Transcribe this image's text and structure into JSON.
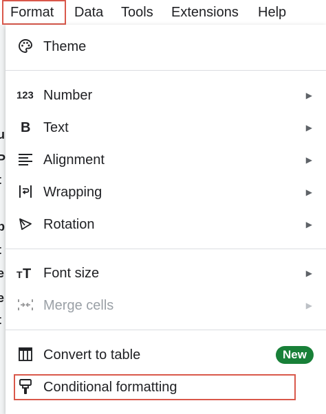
{
  "menubar": {
    "items": [
      {
        "label": "Format"
      },
      {
        "label": "Data"
      },
      {
        "label": "Tools"
      },
      {
        "label": "Extensions"
      },
      {
        "label": "Help"
      }
    ]
  },
  "menu": {
    "theme": {
      "label": "Theme",
      "icon": "palette-icon"
    },
    "number": {
      "label": "Number",
      "icon": "number-123-icon"
    },
    "text": {
      "label": "Text",
      "icon": "bold-icon"
    },
    "alignment": {
      "label": "Alignment",
      "icon": "align-left-icon"
    },
    "wrapping": {
      "label": "Wrapping",
      "icon": "text-wrap-icon"
    },
    "rotation": {
      "label": "Rotation",
      "icon": "text-rotation-icon"
    },
    "font_size": {
      "label": "Font size",
      "icon": "font-size-icon"
    },
    "merge_cells": {
      "label": "Merge cells",
      "icon": "merge-cells-icon",
      "disabled": true
    },
    "convert_to_table": {
      "label": "Convert to table",
      "icon": "table-icon",
      "badge": "New"
    },
    "conditional_formatting": {
      "label": "Conditional formatting",
      "icon": "paint-roller-icon"
    },
    "submenu_arrow": "▶"
  },
  "sheet_edge": [
    "u",
    "P",
    "t",
    "i",
    "p",
    "t",
    "e",
    "e",
    "t"
  ],
  "colors": {
    "highlight": "#d9574a",
    "badge": "#188038"
  }
}
